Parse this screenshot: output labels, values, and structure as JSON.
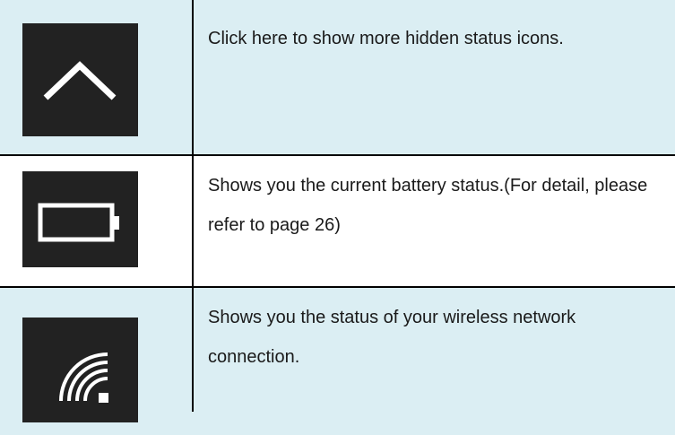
{
  "rows": [
    {
      "icon": "chevron-up-icon",
      "text": "Click here to show more hidden status icons."
    },
    {
      "icon": "battery-icon",
      "text": "Shows you the current battery status.(For detail, please refer to page 26)"
    },
    {
      "icon": "wifi-icon",
      "text": "Shows you the status of your wireless network connection."
    }
  ],
  "colors": {
    "row_shade": "#dbeef3",
    "icon_tile": "#222222",
    "icon_glyph": "#ffffff",
    "grid_line": "#000000"
  }
}
